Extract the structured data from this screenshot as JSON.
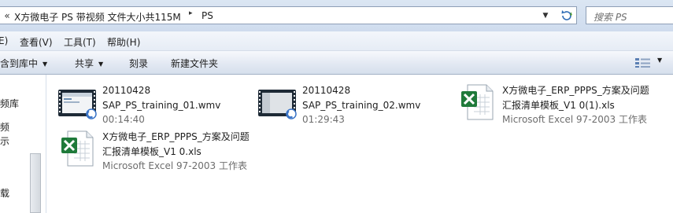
{
  "address_bar": {
    "crumbs": [
      "X方微电子 PS 带视频 文件大小共115M",
      "PS"
    ],
    "overflow_glyph": "«",
    "separator_glyph": "▸",
    "search_placeholder": "搜索 PS"
  },
  "menu": [
    "E)",
    "查看(V)",
    "工具(T)",
    "帮助(H)"
  ],
  "command_bar": {
    "items": [
      {
        "label": "包含到库中",
        "dropdown": true
      },
      {
        "label": "共享",
        "dropdown": true
      },
      {
        "label": "刻录",
        "dropdown": false
      },
      {
        "label": "新建文件夹",
        "dropdown": false
      }
    ],
    "view_icon": "view-options-icon"
  },
  "nav_pane": {
    "items": [
      "视频库",
      "视频",
      "示",
      "下载"
    ]
  },
  "files": [
    {
      "icon": "video-file-icon",
      "line1": "20110428",
      "line2": "SAP_PS_training_01.wmv",
      "line3": "00:14:40"
    },
    {
      "icon": "video-file-icon",
      "line1": "20110428",
      "line2": "SAP_PS_training_02.wmv",
      "line3": "01:29:43"
    },
    {
      "icon": "excel-file-icon",
      "line1": "X方微电子_ERP_PPPS_方案及问题",
      "line2": "汇报清单模板_V1 0(1).xls",
      "line3": "Microsoft Excel 97-2003 工作表"
    },
    {
      "icon": "excel-file-icon",
      "line1": "X方微电子_ERP_PPPS_方案及问题",
      "line2": "汇报清单模板_V1 0.xls",
      "line3": "Microsoft Excel 97-2003 工作表"
    }
  ],
  "colors": {
    "accent": "#cfdcee",
    "meta_text": "#6d6d6d",
    "excel_green": "#1f7a3a"
  }
}
